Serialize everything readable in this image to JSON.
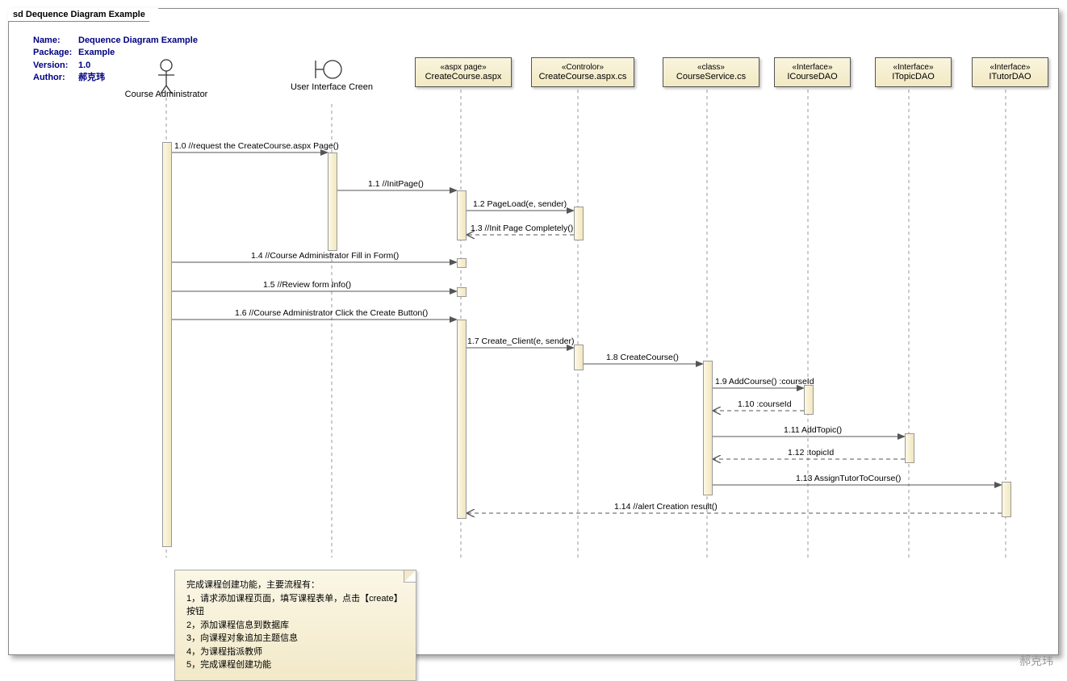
{
  "frame_title": "sd Dequence Diagram Example",
  "meta": {
    "name_label": "Name:",
    "name_value": "Dequence Diagram Example",
    "package_label": "Package:",
    "package_value": "Example",
    "version_label": "Version:",
    "version_value": "1.0",
    "author_label": "Author:",
    "author_value": "郝克玮"
  },
  "lifelines": {
    "actor": "Course Administrator",
    "screen": "User Interface Creen",
    "aspx_stereo": "«aspx page»",
    "aspx_name": "CreateCourse.aspx",
    "ctrl_stereo": "«Controlor»",
    "ctrl_name": "CreateCourse.aspx.cs",
    "svc_stereo": "«class»",
    "svc_name": "CourseService.cs",
    "cdao_stereo": "«Interface»",
    "cdao_name": "ICourseDAO",
    "tdao_stereo": "«Interface»",
    "tdao_name": "ITopicDAO",
    "tutdao_stereo": "«Interface»",
    "tutdao_name": "ITutorDAO"
  },
  "messages": {
    "m1_0": "1.0 //request the CreateCourse.aspx Page()",
    "m1_1": "1.1 //InitPage()",
    "m1_2": "1.2 PageLoad(e, sender)",
    "m1_3": "1.3 //Init Page Completely()",
    "m1_4": "1.4 //Course Administrator Fill in  Form()",
    "m1_5": "1.5 //Review  form Info()",
    "m1_6": "1.6 //Course Administrator Click the Create Button()",
    "m1_7": "1.7 Create_Client(e, sender)",
    "m1_8": "1.8 CreateCourse()",
    "m1_9": "1.9 AddCourse() :courseId",
    "m1_10": "1.10  :courseId",
    "m1_11": "1.11 AddTopic()",
    "m1_12": "1.12  :topicId",
    "m1_13": "1.13 AssignTutorToCourse()",
    "m1_14": "1.14 //alert Creation result()"
  },
  "note": {
    "line0": "完成课程创建功能，主要流程有：",
    "line1": "1，请求添加课程页面，填写课程表单，点击【create】按钮",
    "line2": "2，添加课程信息到数据库",
    "line3": "3，向课程对象追加主题信息",
    "line4": "4，为课程指派教师",
    "line5": "5，完成课程创建功能"
  },
  "watermark": "郝克玮"
}
